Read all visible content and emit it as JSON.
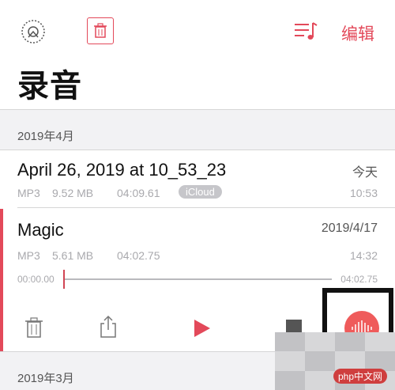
{
  "header": {
    "edit_label": "编辑",
    "title": "录音",
    "icons": {
      "settings": "settings-icon",
      "trash": "trash-icon",
      "playlist": "playlist-icon"
    }
  },
  "sections": [
    {
      "label": "2019年4月",
      "items": [
        {
          "title": "April 26, 2019 at 10_53_23",
          "format": "MP3",
          "size": "9.52 MB",
          "duration": "04:09.61",
          "badge": "iCloud",
          "date": "今天",
          "time": "10:53"
        },
        {
          "title": "Magic",
          "format": "MP3",
          "size": "5.61 MB",
          "duration": "04:02.75",
          "date": "2019/4/17",
          "time": "14:32",
          "player": {
            "start": "00:00.00",
            "end": "04:02.75",
            "progress": 0.0
          }
        }
      ]
    },
    {
      "label": "2019年3月",
      "items": []
    }
  ],
  "colors": {
    "accent": "#e3495a",
    "meta": "#a9a9ad"
  },
  "watermark": "php中文网"
}
